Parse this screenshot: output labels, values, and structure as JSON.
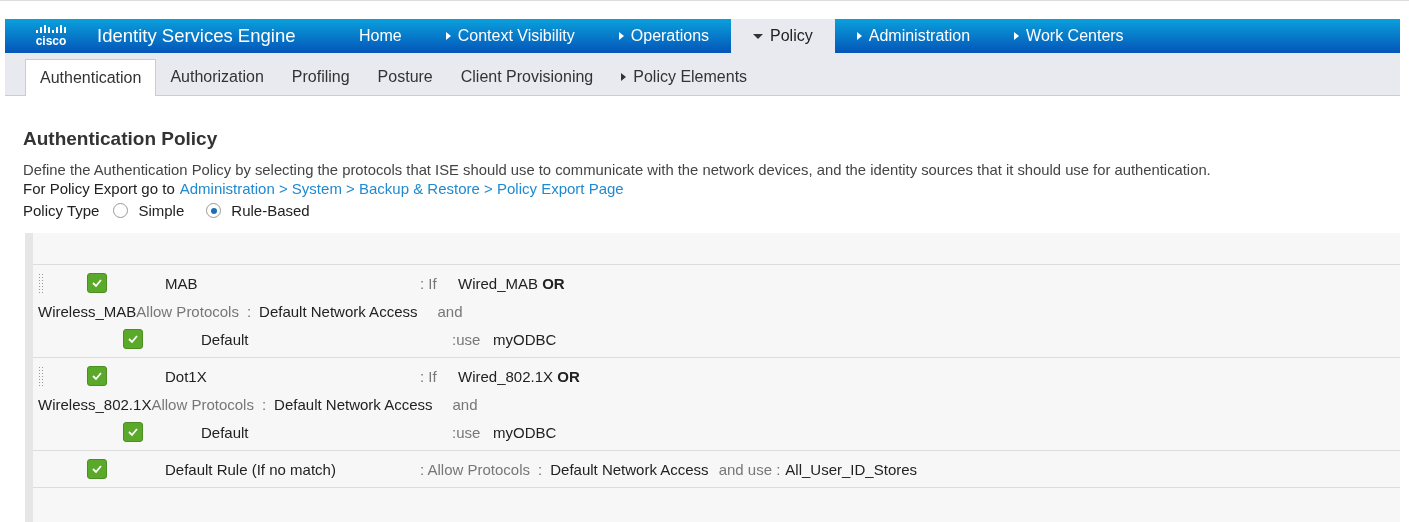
{
  "header": {
    "logo": "cisco",
    "product": "Identity Services Engine",
    "nav": [
      {
        "label": "Home",
        "has_menu": false,
        "selected": false
      },
      {
        "label": "Context Visibility",
        "has_menu": true,
        "selected": false
      },
      {
        "label": "Operations",
        "has_menu": true,
        "selected": false
      },
      {
        "label": "Policy",
        "has_menu": true,
        "selected": true
      },
      {
        "label": "Administration",
        "has_menu": true,
        "selected": false
      },
      {
        "label": "Work Centers",
        "has_menu": true,
        "selected": false
      }
    ]
  },
  "tabs": [
    {
      "label": "Authentication",
      "has_menu": false,
      "selected": true
    },
    {
      "label": "Authorization",
      "has_menu": false,
      "selected": false
    },
    {
      "label": "Profiling",
      "has_menu": false,
      "selected": false
    },
    {
      "label": "Posture",
      "has_menu": false,
      "selected": false
    },
    {
      "label": "Client Provisioning",
      "has_menu": false,
      "selected": false
    },
    {
      "label": "Policy Elements",
      "has_menu": true,
      "selected": false
    }
  ],
  "title": "Authentication Policy",
  "description": "Define the Authentication Policy by selecting the protocols that ISE should use to communicate with the network devices, and the identity sources that it should use for authentication.",
  "export": {
    "prefix": "For Policy Export go to",
    "link": "Administration > System > Backup & Restore > Policy Export Page"
  },
  "policy_type": {
    "label": "Policy Type",
    "options": [
      {
        "label": "Simple",
        "selected": false
      },
      {
        "label": "Rule-Based",
        "selected": true
      }
    ]
  },
  "rules": [
    {
      "kind": "conditional",
      "enabled": true,
      "name": "MAB",
      "if_label": ": If",
      "condition": "Wired_MAB **OR**",
      "condition_cont": "Wireless_MAB",
      "allow_label": "Allow Protocols",
      "sep": ":",
      "protocols": "Default Network Access",
      "and": "and",
      "sub_rule": {
        "enabled": true,
        "name": "Default",
        "use_label": ":use",
        "source": "myODBC"
      }
    },
    {
      "kind": "conditional",
      "enabled": true,
      "name": "Dot1X",
      "if_label": ": If",
      "condition": "Wired_802.1X **OR**",
      "condition_cont": "Wireless_802.1X",
      "allow_label": "Allow Protocols",
      "sep": ":",
      "protocols": "Default Network Access",
      "and": "and",
      "sub_rule": {
        "enabled": true,
        "name": "Default",
        "use_label": ":use",
        "source": "myODBC"
      }
    },
    {
      "kind": "default",
      "enabled": true,
      "name": "Default Rule (If no match)",
      "allow_label": ": Allow Protocols",
      "sep": ":",
      "protocols": "Default Network Access",
      "and_use": "and use :",
      "source": "All_User_ID_Stores"
    }
  ]
}
